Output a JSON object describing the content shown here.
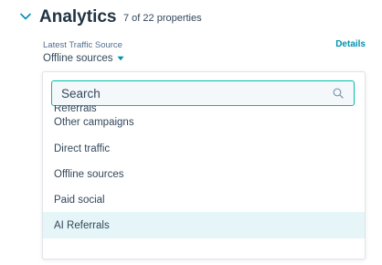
{
  "section": {
    "title": "Analytics",
    "count": "7 of 22 properties"
  },
  "property": {
    "label": "Latest Traffic Source",
    "details_link": "Details",
    "value": "Offline sources"
  },
  "dropdown": {
    "search_placeholder": "Search",
    "partial_option": "Referrals",
    "options": [
      {
        "label": "Other campaigns"
      },
      {
        "label": "Direct traffic"
      },
      {
        "label": "Offline sources"
      },
      {
        "label": "Paid social"
      },
      {
        "label": "AI Referrals"
      }
    ],
    "highlighted_option": "AI Referrals"
  },
  "colors": {
    "accent_teal": "#00bda5",
    "link": "#0091ae",
    "highlight_bg": "#e5f5f8",
    "text": "#33475b"
  },
  "icons": {
    "collapse": "chevron-down-icon",
    "dropdown_caret": "caret-down-icon",
    "search": "search-icon"
  }
}
